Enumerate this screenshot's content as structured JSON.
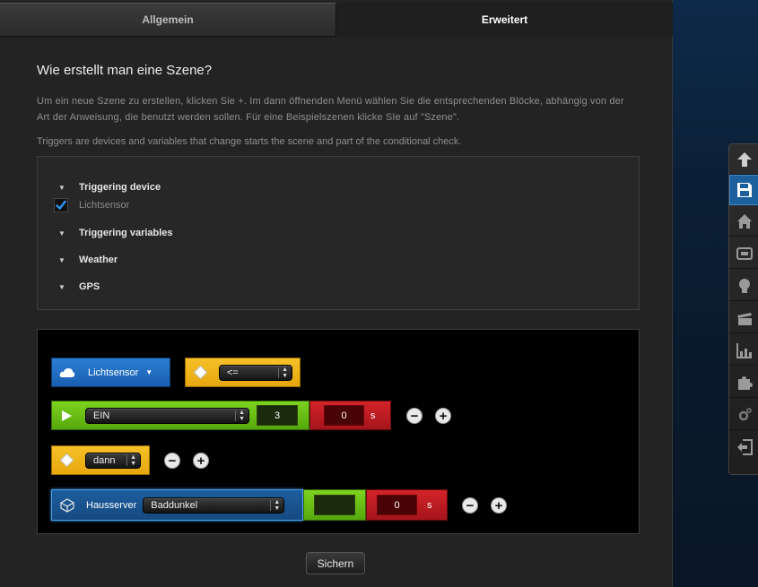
{
  "tabs": [
    {
      "label": "Allgemein",
      "active": false
    },
    {
      "label": "Erweitert",
      "active": true
    }
  ],
  "content": {
    "title": "Wie erstellt man eine Szene?",
    "description": "Um ein neue Szene zu erstellen, klicken Sie +. Im dann öffnenden Menü wählen Sie die entsprechenden Blöcke, abhängig von der Art der Anweisung, die benutzt werden sollen. Für eine Beispielszenen klicke SIe auf \"Szene\".",
    "triggers_info": "Triggers are devices and variables that change starts the scene and part of the conditional check."
  },
  "triggers": {
    "groups": [
      {
        "label": "Triggering device",
        "expanded": true
      },
      {
        "label": "Triggering variables",
        "expanded": false
      },
      {
        "label": "Weather",
        "expanded": false
      },
      {
        "label": "GPS",
        "expanded": false
      }
    ],
    "device_item": {
      "label": "Lichtsensor",
      "checked": true
    }
  },
  "scene": {
    "device_block": {
      "label": "Lichtsensor",
      "icon": "cloud-icon",
      "color": "#1f6cc2"
    },
    "operator_block": {
      "value": "<=",
      "icon": "diamond-icon",
      "color": "#f2b418"
    },
    "state_block": {
      "value": "EIN",
      "number": "3",
      "icon": "play-icon",
      "color": "#6abd14"
    },
    "state_delay": {
      "value": "0",
      "unit": "s",
      "color": "#bf1c22"
    },
    "then_block": {
      "value": "dann",
      "icon": "diamond-icon"
    },
    "action_block": {
      "label": "Hausserver",
      "value": "Baddunkel",
      "icon": "cube-icon"
    },
    "action_green": {
      "value": ""
    },
    "action_delay": {
      "value": "0",
      "unit": "s"
    }
  },
  "buttons": {
    "save": "Sichern",
    "remove": "−",
    "add": "+"
  },
  "toolbar": {
    "items": [
      "arrow-up-icon",
      "save-icon",
      "home-icon",
      "devices-icon",
      "bulb-icon",
      "clapper-icon",
      "chart-icon",
      "puzzle-icon",
      "settings-icon",
      "logout-icon"
    ],
    "active": "save-icon"
  }
}
